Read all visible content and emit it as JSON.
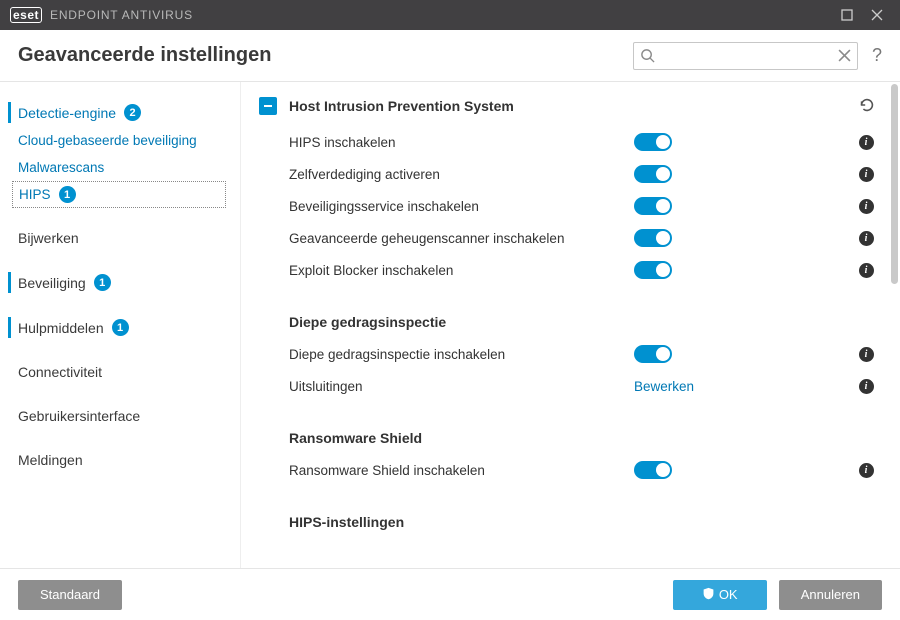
{
  "brand": {
    "logo": "eset",
    "product": "ENDPOINT ANTIVIRUS"
  },
  "header": {
    "title": "Geavanceerde instellingen",
    "search_placeholder": ""
  },
  "sidebar": {
    "items": [
      {
        "label": "Detectie-engine",
        "badge": "2"
      },
      {
        "label": "Cloud-gebaseerde beveiliging"
      },
      {
        "label": "Malwarescans"
      },
      {
        "label": "HIPS",
        "badge": "1"
      },
      {
        "label": "Bijwerken"
      },
      {
        "label": "Beveiliging",
        "badge": "1"
      },
      {
        "label": "Hulpmiddelen",
        "badge": "1"
      },
      {
        "label": "Connectiviteit"
      },
      {
        "label": "Gebruikersinterface"
      },
      {
        "label": "Meldingen"
      }
    ]
  },
  "content": {
    "section_title": "Host Intrusion Prevention System",
    "rows": [
      {
        "label": "HIPS inschakelen",
        "toggle": true
      },
      {
        "label": "Zelfverdediging activeren",
        "toggle": true
      },
      {
        "label": "Beveiligingsservice inschakelen",
        "toggle": true
      },
      {
        "label": "Geavanceerde geheugenscanner inschakelen",
        "toggle": true
      },
      {
        "label": "Exploit Blocker inschakelen",
        "toggle": true
      }
    ],
    "deep_heading": "Diepe gedragsinspectie",
    "deep_rows": [
      {
        "label": "Diepe gedragsinspectie inschakelen",
        "toggle": true
      }
    ],
    "exclusions_label": "Uitsluitingen",
    "exclusions_link": "Bewerken",
    "ransom_heading": "Ransomware Shield",
    "ransom_rows": [
      {
        "label": "Ransomware Shield inschakelen",
        "toggle": true
      }
    ],
    "hips_settings_heading": "HIPS-instellingen"
  },
  "footer": {
    "default": "Standaard",
    "ok": "OK",
    "cancel": "Annuleren"
  }
}
